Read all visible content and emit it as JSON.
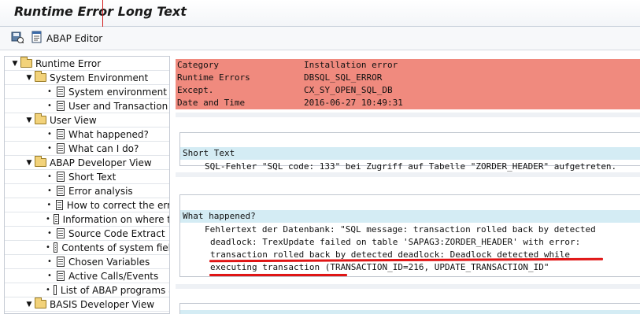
{
  "window": {
    "title": "Runtime Error Long Text"
  },
  "toolbar": {
    "items": [
      {
        "icon": "save-display-icon",
        "label": ""
      },
      {
        "icon": "abap-editor-icon",
        "label": "ABAP Editor"
      }
    ]
  },
  "tree": {
    "root": {
      "label": "Runtime Error"
    },
    "system_environment": {
      "label": "System Environment",
      "items": [
        "System environment",
        "User and Transaction"
      ]
    },
    "user_view": {
      "label": "User View",
      "items": [
        "What happened?",
        "What can I do?"
      ]
    },
    "abap_developer_view": {
      "label": "ABAP Developer View",
      "items": [
        "Short Text",
        "Error analysis",
        "How to correct the err",
        "Information on where t",
        "Source Code Extract",
        "Contents of system fiel",
        "Chosen Variables",
        "Active Calls/Events",
        "List of ABAP programs a"
      ]
    },
    "basis_developer_view": {
      "label": "BASIS Developer View"
    }
  },
  "error_header": {
    "rows": [
      {
        "key": "Category",
        "value": "Installation error"
      },
      {
        "key": "Runtime Errors",
        "value": "DBSQL_SQL_ERROR"
      },
      {
        "key": "Except.",
        "value": "CX_SY_OPEN_SQL_DB"
      },
      {
        "key": "Date and Time",
        "value": "2016-06-27 10:49:31"
      }
    ]
  },
  "short_text": {
    "heading": "Short Text",
    "body": "SQL-Fehler \"SQL code: 133\" bei Zugriff auf Tabelle \"ZORDER_HEADER\" aufgetreten."
  },
  "what_happened": {
    "heading": "What happened?",
    "lines": [
      "Fehlertext der Datenbank: \"SQL message: transaction rolled back by detected",
      "deadlock: TrexUpdate failed on table 'SAPAG3:ZORDER_HEADER' with error:",
      "transaction rolled back by detected deadlock: Deadlock detected while",
      "executing transaction (TRANSACTION_ID=216, UPDATE_TRANSACTION_ID\""
    ]
  },
  "colors": {
    "error_header_bg": "#f08a7e",
    "section_header_bg": "#d4ecf4",
    "highlight_underline": "#e01515"
  }
}
